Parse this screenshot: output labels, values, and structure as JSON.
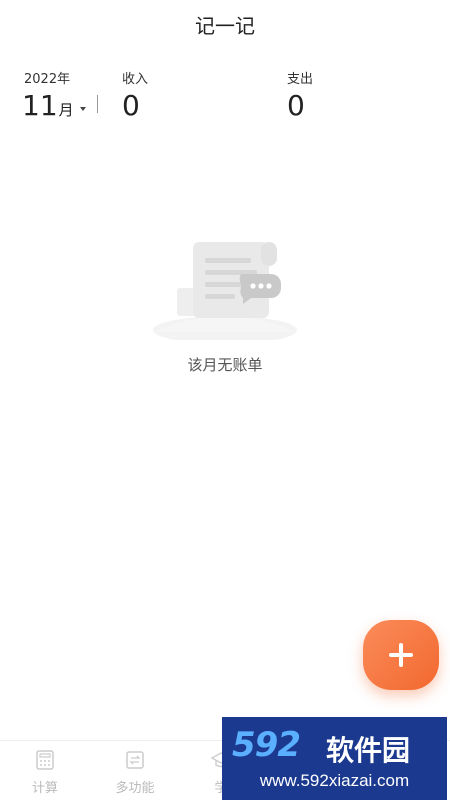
{
  "header": {
    "title": "记一记"
  },
  "summary": {
    "year": "2022年",
    "month": "11",
    "month_unit": "月",
    "income_label": "收入",
    "income_value": "0",
    "expense_label": "支出",
    "expense_value": "0"
  },
  "empty_state": {
    "message": "该月无账单"
  },
  "fab": {
    "icon": "plus-icon",
    "color": "#f2682f"
  },
  "bottom_nav": {
    "items": [
      {
        "label": "计算",
        "icon": "calculator-icon"
      },
      {
        "label": "多功能",
        "icon": "multi-function-icon"
      },
      {
        "label": "学",
        "icon": "graduation-cap-icon"
      }
    ]
  },
  "watermark": {
    "logo": "592",
    "brand": "软件园",
    "url": "www.592xiazai.com"
  },
  "colors": {
    "accent": "#f2682f",
    "text_primary": "#222222",
    "text_muted": "#bbbbbb",
    "watermark_bg": "#1b3a8f"
  }
}
